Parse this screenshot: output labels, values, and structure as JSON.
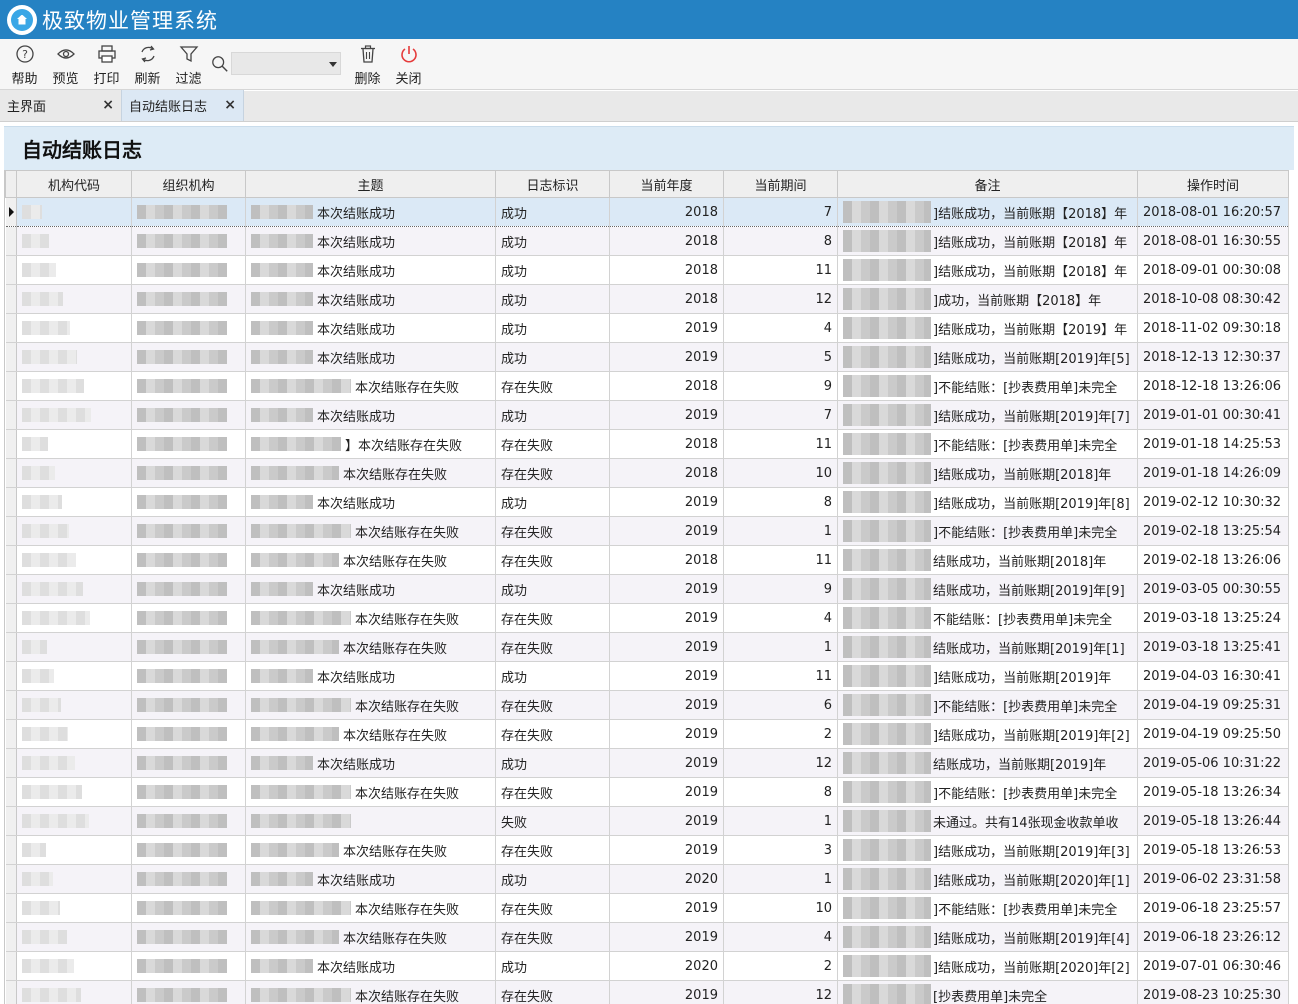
{
  "app": {
    "title": "极致物业管理系统"
  },
  "toolbar": {
    "help": "帮助",
    "preview": "预览",
    "print": "打印",
    "refresh": "刷新",
    "filter": "过滤",
    "search_value": "",
    "delete": "删除",
    "close": "关闭"
  },
  "tabs": [
    {
      "label": "主界面",
      "close": "×"
    },
    {
      "label": "自动结账日志",
      "close": "×"
    }
  ],
  "page": {
    "title": "自动结账日志"
  },
  "grid": {
    "columns": [
      "机构代码",
      "组织机构",
      "主题",
      "日志标识",
      "当前年度",
      "当前期间",
      "备注",
      "操作时间"
    ],
    "rows": [
      {
        "subject": "本次结账成功",
        "flag": "成功",
        "year": "2018",
        "period": "7",
        "remark": "]结账成功，当前账期【2018】年",
        "time": "2018-08-01 16:20:57"
      },
      {
        "subject": "本次结账成功",
        "flag": "成功",
        "year": "2018",
        "period": "8",
        "remark": "]结账成功，当前账期【2018】年",
        "time": "2018-08-01 16:30:55"
      },
      {
        "subject": "本次结账成功",
        "flag": "成功",
        "year": "2018",
        "period": "11",
        "remark": "]结账成功，当前账期【2018】年",
        "time": "2018-09-01 00:30:08"
      },
      {
        "subject": "本次结账成功",
        "flag": "成功",
        "year": "2018",
        "period": "12",
        "remark": "]成功，当前账期【2018】年",
        "time": "2018-10-08 08:30:42"
      },
      {
        "subject": "本次结账成功",
        "flag": "成功",
        "year": "2019",
        "period": "4",
        "remark": "]结账成功，当前账期【2019】年",
        "time": "2018-11-02 09:30:18"
      },
      {
        "subject": "本次结账成功",
        "flag": "成功",
        "year": "2019",
        "period": "5",
        "remark": "]结账成功，当前账期[2019]年[5]",
        "time": "2018-12-13 12:30:37"
      },
      {
        "subject": "本次结账存在失败",
        "flag": "存在失败",
        "year": "2018",
        "period": "9",
        "remark": "]不能结账：[抄表费用单]未完全",
        "time": "2018-12-18 13:26:06"
      },
      {
        "subject": "本次结账成功",
        "flag": "成功",
        "year": "2019",
        "period": "7",
        "remark": "]结账成功，当前账期[2019]年[7]",
        "time": "2019-01-01 00:30:41"
      },
      {
        "subject": "】本次结账存在失败",
        "flag": "存在失败",
        "year": "2018",
        "period": "11",
        "remark": "]不能结账：[抄表费用单]未完全",
        "time": "2019-01-18 14:25:53"
      },
      {
        "subject": "本次结账存在失败",
        "flag": "存在失败",
        "year": "2018",
        "period": "10",
        "remark": "]结账成功，当前账期[2018]年",
        "time": "2019-01-18 14:26:09"
      },
      {
        "subject": "本次结账成功",
        "flag": "成功",
        "year": "2019",
        "period": "8",
        "remark": "]结账成功，当前账期[2019]年[8]",
        "time": "2019-02-12 10:30:32"
      },
      {
        "subject": "本次结账存在失败",
        "flag": "存在失败",
        "year": "2019",
        "period": "1",
        "remark": "]不能结账：[抄表费用单]未完全",
        "time": "2019-02-18 13:25:54"
      },
      {
        "subject": "本次结账存在失败",
        "flag": "存在失败",
        "year": "2018",
        "period": "11",
        "remark": "结账成功，当前账期[2018]年",
        "time": "2019-02-18 13:26:06"
      },
      {
        "subject": "本次结账成功",
        "flag": "成功",
        "year": "2019",
        "period": "9",
        "remark": "结账成功，当前账期[2019]年[9]",
        "time": "2019-03-05 00:30:55"
      },
      {
        "subject": "本次结账存在失败",
        "flag": "存在失败",
        "year": "2019",
        "period": "4",
        "remark": "不能结账：[抄表费用单]未完全",
        "time": "2019-03-18 13:25:24"
      },
      {
        "subject": "本次结账存在失败",
        "flag": "存在失败",
        "year": "2019",
        "period": "1",
        "remark": "结账成功，当前账期[2019]年[1]",
        "time": "2019-03-18 13:25:41"
      },
      {
        "subject": "本次结账成功",
        "flag": "成功",
        "year": "2019",
        "period": "11",
        "remark": "]结账成功，当前账期[2019]年",
        "time": "2019-04-03 16:30:41"
      },
      {
        "subject": "本次结账存在失败",
        "flag": "存在失败",
        "year": "2019",
        "period": "6",
        "remark": "]不能结账：[抄表费用单]未完全",
        "time": "2019-04-19 09:25:31"
      },
      {
        "subject": "本次结账存在失败",
        "flag": "存在失败",
        "year": "2019",
        "period": "2",
        "remark": "]结账成功，当前账期[2019]年[2]",
        "time": "2019-04-19 09:25:50"
      },
      {
        "subject": "本次结账成功",
        "flag": "成功",
        "year": "2019",
        "period": "12",
        "remark": "结账成功，当前账期[2019]年",
        "time": "2019-05-06 10:31:22"
      },
      {
        "subject": "本次结账存在失败",
        "flag": "存在失败",
        "year": "2019",
        "period": "8",
        "remark": "]不能结账：[抄表费用单]未完全",
        "time": "2019-05-18 13:26:34"
      },
      {
        "subject": "",
        "flag": "失败",
        "year": "2019",
        "period": "1",
        "remark": "未通过。共有14张现金收款单收",
        "time": "2019-05-18 13:26:44"
      },
      {
        "subject": "本次结账存在失败",
        "flag": "存在失败",
        "year": "2019",
        "period": "3",
        "remark": "]结账成功，当前账期[2019]年[3]",
        "time": "2019-05-18 13:26:53"
      },
      {
        "subject": "本次结账成功",
        "flag": "成功",
        "year": "2020",
        "period": "1",
        "remark": "]结账成功，当前账期[2020]年[1]",
        "time": "2019-06-02 23:31:58"
      },
      {
        "subject": "本次结账存在失败",
        "flag": "存在失败",
        "year": "2019",
        "period": "10",
        "remark": "]不能结账：[抄表费用单]未完全",
        "time": "2019-06-18 23:25:57"
      },
      {
        "subject": "本次结账存在失败",
        "flag": "存在失败",
        "year": "2019",
        "period": "4",
        "remark": "]结账成功，当前账期[2019]年[4]",
        "time": "2019-06-18 23:26:12"
      },
      {
        "subject": "本次结账成功",
        "flag": "成功",
        "year": "2020",
        "period": "2",
        "remark": "]结账成功，当前账期[2020]年[2]",
        "time": "2019-07-01 06:30:46"
      },
      {
        "subject": "本次结账存在失败",
        "flag": "存在失败",
        "year": "2019",
        "period": "12",
        "remark": "[抄表费用单]未完全",
        "time": "2019-08-23 10:25:30"
      }
    ]
  }
}
